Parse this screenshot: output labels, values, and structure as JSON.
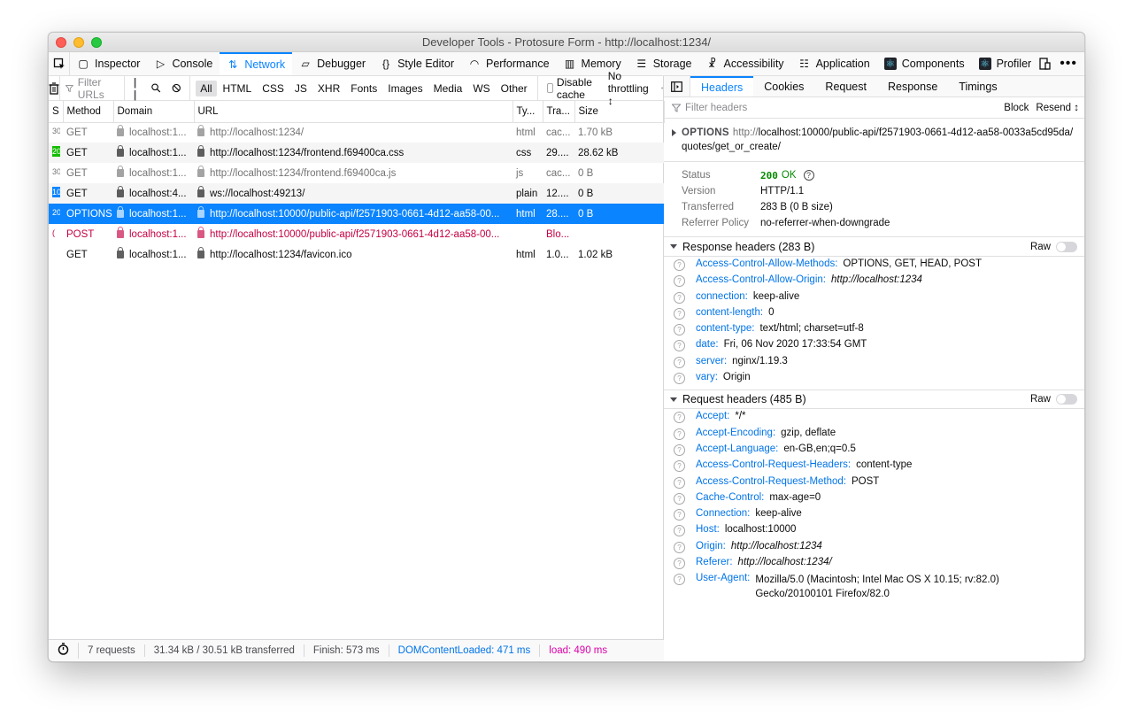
{
  "window": {
    "title": "Developer Tools - Protosure Form - http://localhost:1234/"
  },
  "toolbox": {
    "tabs": [
      {
        "label": "Inspector",
        "icon": "inspector-icon"
      },
      {
        "label": "Console",
        "icon": "console-icon"
      },
      {
        "label": "Network",
        "icon": "network-icon"
      },
      {
        "label": "Debugger",
        "icon": "debugger-icon"
      },
      {
        "label": "Style Editor",
        "icon": "style-editor-icon"
      },
      {
        "label": "Performance",
        "icon": "performance-icon"
      },
      {
        "label": "Memory",
        "icon": "memory-icon"
      },
      {
        "label": "Storage",
        "icon": "storage-icon"
      },
      {
        "label": "Accessibility",
        "icon": "accessibility-icon"
      },
      {
        "label": "Application",
        "icon": "application-icon"
      },
      {
        "label": "Components",
        "icon": "react-components-icon"
      },
      {
        "label": "Profiler",
        "icon": "react-profiler-icon"
      }
    ],
    "selected": "Network"
  },
  "filterbar": {
    "placeholder": "Filter URLs",
    "types": [
      "All",
      "HTML",
      "CSS",
      "JS",
      "XHR",
      "Fonts",
      "Images",
      "Media",
      "WS",
      "Other"
    ],
    "active_type": "All",
    "disable_cache": "Disable cache",
    "throttling": "No throttling ↕"
  },
  "table": {
    "columns": [
      "S",
      "Method",
      "Domain",
      "URL",
      "Ty...",
      "Tra...",
      "Size"
    ],
    "rows": [
      {
        "status": "30",
        "method": "GET",
        "domain": "localhost:1...",
        "url": "http://localhost:1234/",
        "type": "html",
        "transferred": "cac...",
        "size": "1.70 kB"
      },
      {
        "status": "20",
        "method": "GET",
        "domain": "localhost:1...",
        "url": "http://localhost:1234/frontend.f69400ca.css",
        "type": "css",
        "transferred": "29....",
        "size": "28.62 kB"
      },
      {
        "status": "30",
        "method": "GET",
        "domain": "localhost:1...",
        "url": "http://localhost:1234/frontend.f69400ca.js",
        "type": "js",
        "transferred": "cac...",
        "size": "0 B"
      },
      {
        "status": "10",
        "method": "GET",
        "domain": "localhost:4...",
        "url": "ws://localhost:49213/",
        "type": "plain",
        "transferred": "12....",
        "size": "0 B"
      },
      {
        "status": "20",
        "method": "OPTIONS",
        "domain": "localhost:1...",
        "url": "http://localhost:10000/public-api/f2571903-0661-4d12-aa58-00...",
        "type": "html",
        "transferred": "28....",
        "size": "0 B"
      },
      {
        "status": "(",
        "method": "POST",
        "domain": "localhost:1...",
        "url": "http://localhost:10000/public-api/f2571903-0661-4d12-aa58-00...",
        "type": "",
        "transferred": "Blo...",
        "size": ""
      },
      {
        "status": "",
        "method": "GET",
        "domain": "localhost:1...",
        "url": "http://localhost:1234/favicon.ico",
        "type": "html",
        "transferred": "1.0...",
        "size": "1.02 kB"
      }
    ]
  },
  "statusbar": {
    "requests": "7 requests",
    "transferred": "31.34 kB / 30.51 kB transferred",
    "finish": "Finish: 573 ms",
    "dcl": "DOMContentLoaded: 471 ms",
    "load": "load: 490 ms"
  },
  "details": {
    "tabs": [
      "Headers",
      "Cookies",
      "Request",
      "Response",
      "Timings"
    ],
    "selected_tab": "Headers",
    "filter_placeholder": "Filter headers",
    "block": "Block",
    "resend": "Resend ↕",
    "method": "OPTIONS",
    "url_host": "http://",
    "url_rest": "localhost:10000/public-api/f2571903-0661-4d12-aa58-0033a5cd95da/quotes/get_or_create/",
    "summary": {
      "status_label": "Status",
      "status_code": "200",
      "status_text": "OK",
      "version_label": "Version",
      "version": "HTTP/1.1",
      "transferred_label": "Transferred",
      "transferred": "283 B (0 B size)",
      "referrer_label": "Referrer Policy",
      "referrer": "no-referrer-when-downgrade"
    },
    "response_headers_title": "Response headers (283 B)",
    "request_headers_title": "Request headers (485 B)",
    "raw": "Raw",
    "response_headers": [
      {
        "name": "Access-Control-Allow-Methods:",
        "value": "OPTIONS, GET, HEAD, POST"
      },
      {
        "name": "Access-Control-Allow-Origin:",
        "value": "http://localhost:1234",
        "italic": true
      },
      {
        "name": "connection:",
        "value": "keep-alive"
      },
      {
        "name": "content-length:",
        "value": "0"
      },
      {
        "name": "content-type:",
        "value": "text/html; charset=utf-8"
      },
      {
        "name": "date:",
        "value": "Fri, 06 Nov 2020 17:33:54 GMT"
      },
      {
        "name": "server:",
        "value": "nginx/1.19.3"
      },
      {
        "name": "vary:",
        "value": "Origin"
      }
    ],
    "request_headers": [
      {
        "name": "Accept:",
        "value": "*/*"
      },
      {
        "name": "Accept-Encoding:",
        "value": "gzip, deflate"
      },
      {
        "name": "Accept-Language:",
        "value": "en-GB,en;q=0.5"
      },
      {
        "name": "Access-Control-Request-Headers:",
        "value": "content-type"
      },
      {
        "name": "Access-Control-Request-Method:",
        "value": "POST"
      },
      {
        "name": "Cache-Control:",
        "value": "max-age=0"
      },
      {
        "name": "Connection:",
        "value": "keep-alive"
      },
      {
        "name": "Host:",
        "value": "localhost:10000"
      },
      {
        "name": "Origin:",
        "value": "http://localhost:1234",
        "italic": true
      },
      {
        "name": "Referer:",
        "value": "http://localhost:1234/",
        "italic": true
      },
      {
        "name": "User-Agent:",
        "value": "Mozilla/5.0 (Macintosh; Intel Mac OS X 10.15; rv:82.0) Gecko/20100101 Firefox/82.0",
        "wrap": true
      }
    ]
  },
  "colors": {
    "accent": "#0a84ff",
    "error": "#c50042",
    "ok": "#058b00",
    "dcl": "#0074e8",
    "load": "#dd00a9"
  }
}
